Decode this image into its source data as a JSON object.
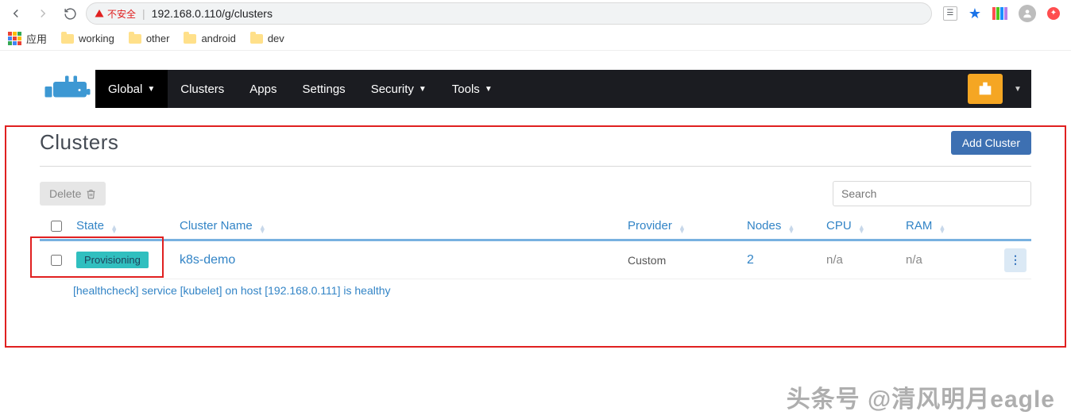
{
  "browser": {
    "insecure_label": "不安全",
    "url": "192.168.0.110/g/clusters"
  },
  "bookmarks": {
    "apps_label": "应用",
    "items": [
      "working",
      "other",
      "android",
      "dev"
    ]
  },
  "nav": {
    "items": [
      {
        "label": "Global",
        "active": true,
        "caret": true
      },
      {
        "label": "Clusters",
        "active": false,
        "caret": false
      },
      {
        "label": "Apps",
        "active": false,
        "caret": false
      },
      {
        "label": "Settings",
        "active": false,
        "caret": false
      },
      {
        "label": "Security",
        "active": false,
        "caret": true
      },
      {
        "label": "Tools",
        "active": false,
        "caret": true
      }
    ]
  },
  "page": {
    "title": "Clusters",
    "add_button": "Add Cluster",
    "delete_button": "Delete",
    "search_placeholder": "Search"
  },
  "table": {
    "columns": {
      "state": "State",
      "name": "Cluster Name",
      "provider": "Provider",
      "nodes": "Nodes",
      "cpu": "CPU",
      "ram": "RAM"
    },
    "rows": [
      {
        "state": "Provisioning",
        "name": "k8s-demo",
        "provider": "Custom",
        "nodes": "2",
        "cpu": "n/a",
        "ram": "n/a",
        "subtext": "[healthcheck] service [kubelet] on host [192.168.0.111] is healthy"
      }
    ]
  },
  "watermark": "头条号 @清风明月eagle"
}
